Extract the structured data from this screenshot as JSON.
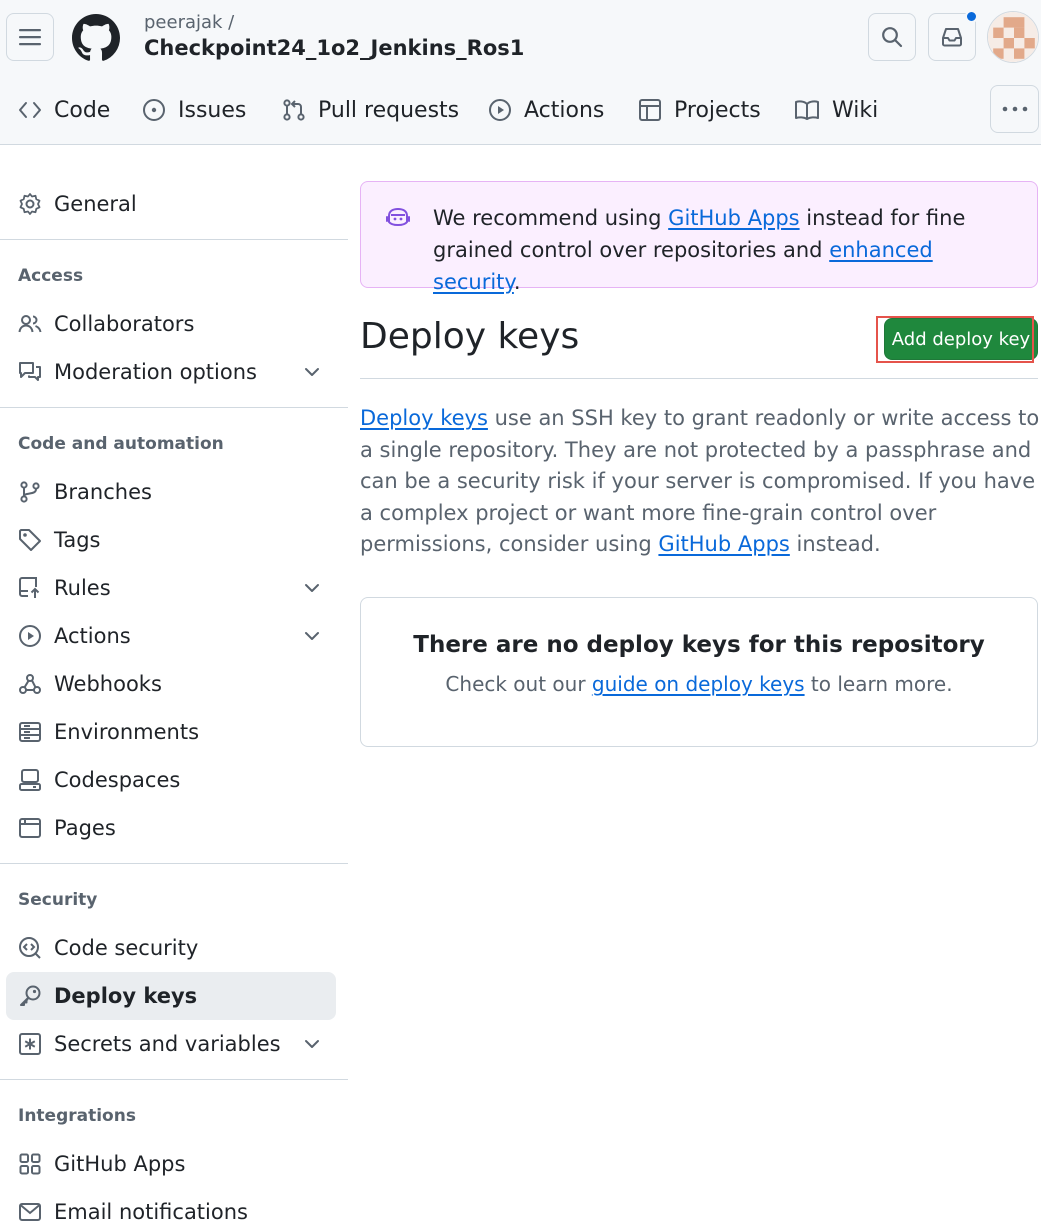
{
  "header": {
    "owner": "peerajak /",
    "repo": "Checkpoint24_1o2_Jenkins_Ros1",
    "tabs": [
      {
        "label": "Code",
        "icon": "code-icon"
      },
      {
        "label": "Issues",
        "icon": "issue-icon"
      },
      {
        "label": "Pull requests",
        "icon": "pull-request-icon"
      },
      {
        "label": "Actions",
        "icon": "play-icon"
      },
      {
        "label": "Projects",
        "icon": "table-icon"
      },
      {
        "label": "Wiki",
        "icon": "book-icon"
      }
    ]
  },
  "sidebar": {
    "general": "General",
    "sections": {
      "access": "Access",
      "code_automation": "Code and automation",
      "security": "Security",
      "integrations": "Integrations"
    },
    "items": {
      "collaborators": "Collaborators",
      "moderation": "Moderation options",
      "branches": "Branches",
      "tags": "Tags",
      "rules": "Rules",
      "actions": "Actions",
      "webhooks": "Webhooks",
      "environments": "Environments",
      "codespaces": "Codespaces",
      "pages": "Pages",
      "code_security": "Code security",
      "deploy_keys": "Deploy keys",
      "secrets": "Secrets and variables",
      "github_apps": "GitHub Apps",
      "email_notifications": "Email notifications"
    },
    "active": "deploy_keys"
  },
  "flash": {
    "text_1": "We recommend using ",
    "link_1": "GitHub Apps",
    "text_2": " instead for fine grained control over repositories and ",
    "link_2": "enhanced security",
    "text_3": "."
  },
  "main": {
    "title": "Deploy keys",
    "add_button": "Add deploy key",
    "desc_link_1": "Deploy keys",
    "desc_text_1": " use an SSH key to grant readonly or write access to a single repository. They are not protected by a passphrase and can be a security risk if your server is compromised. If you have a complex project or want more fine-grain control over permissions, consider using ",
    "desc_link_2": "GitHub Apps",
    "desc_text_2": " instead.",
    "blank_title": "There are no deploy keys for this repository",
    "blank_text_1": "Check out our ",
    "blank_link": "guide on deploy keys",
    "blank_text_2": " to learn more."
  },
  "colors": {
    "accent_green": "#1f883d",
    "link_blue": "#0969da",
    "flash_bg": "#fbefff",
    "notification_dot": "#0969da"
  }
}
